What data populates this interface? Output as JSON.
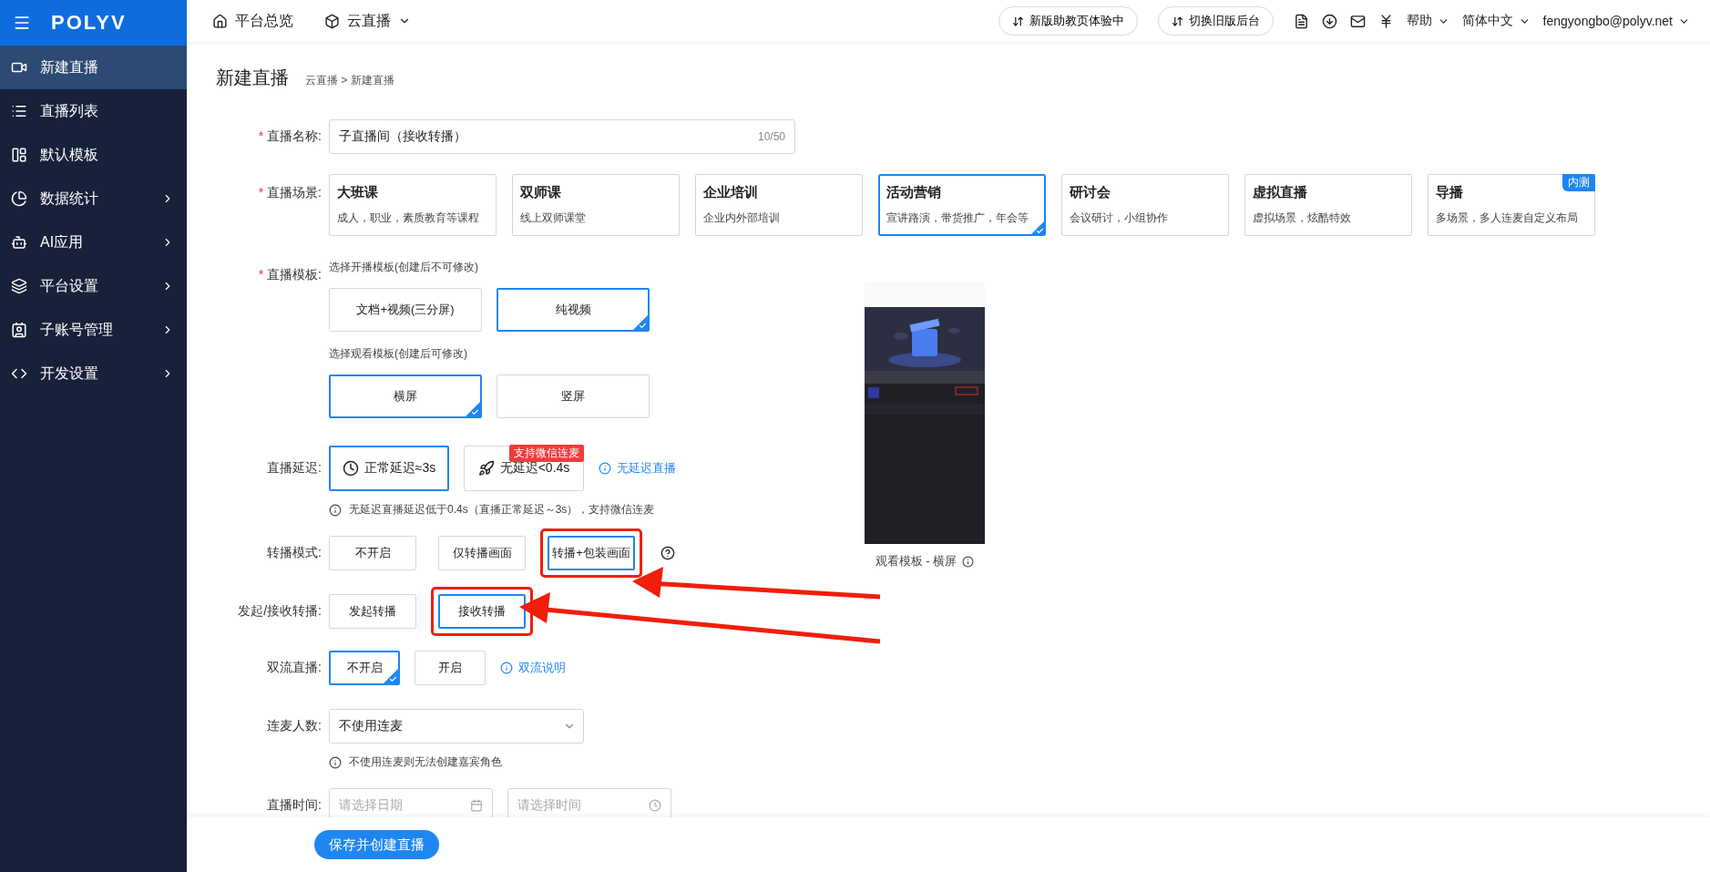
{
  "topbar": {
    "logo": "POLYV",
    "nav": [
      "平台总览",
      "云直播"
    ],
    "buttons": [
      "新版助教页体验中",
      "切换旧版后台"
    ],
    "help": "帮助",
    "language": "简体中文",
    "user": "fengyongbo@polyv.net"
  },
  "sidebar": {
    "items": [
      {
        "label": "新建直播",
        "selected": true,
        "has_submenu": false
      },
      {
        "label": "直播列表",
        "selected": false,
        "has_submenu": false
      },
      {
        "label": "默认模板",
        "selected": false,
        "has_submenu": false
      },
      {
        "label": "数据统计",
        "selected": false,
        "has_submenu": true
      },
      {
        "label": "AI应用",
        "selected": false,
        "has_submenu": true
      },
      {
        "label": "平台设置",
        "selected": false,
        "has_submenu": true
      },
      {
        "label": "子账号管理",
        "selected": false,
        "has_submenu": true
      },
      {
        "label": "开发设置",
        "selected": false,
        "has_submenu": true
      }
    ]
  },
  "page": {
    "title": "新建直播",
    "breadcrumb": "云直播 > 新建直播"
  },
  "name": {
    "label": "直播名称:",
    "required_mark": "*",
    "value": "子直播间（接收转播）",
    "counter": "10/50"
  },
  "scene": {
    "label": "直播场景:",
    "required_mark": "*",
    "options": [
      {
        "title": "大班课",
        "desc": "成人，职业，素质教育等课程",
        "selected": false
      },
      {
        "title": "双师课",
        "desc": "线上双师课堂",
        "selected": false
      },
      {
        "title": "企业培训",
        "desc": "企业内外部培训",
        "selected": false
      },
      {
        "title": "活动营销",
        "desc": "宣讲路演，带货推广，年会等",
        "selected": true
      },
      {
        "title": "研讨会",
        "desc": "会议研讨，小组协作",
        "selected": false
      },
      {
        "title": "虚拟直播",
        "desc": "虚拟场景，炫酷特效",
        "selected": false
      },
      {
        "title": "导播",
        "desc": "多场景，多人连麦自定义布局",
        "selected": false,
        "badge": "内测"
      }
    ]
  },
  "template": {
    "label": "直播模板:",
    "required_mark": "*",
    "hint": "选择开播模板(创建后不可修改)",
    "options": [
      {
        "label": "文档+视频(三分屏)",
        "selected": false
      },
      {
        "label": "纯视频",
        "selected": true
      }
    ],
    "watch_hint": "选择观看模板(创建后可修改)",
    "watch_options": [
      {
        "label": "横屏",
        "selected": true
      },
      {
        "label": "竖屏",
        "selected": false
      }
    ],
    "preview_caption": "观看模板 - 横屏"
  },
  "delay": {
    "label": "直播延迟:",
    "options": [
      {
        "label": "正常延迟≈3s",
        "selected": true
      },
      {
        "label": "无延迟<0.4s",
        "selected": false,
        "badge": "支持微信连麦"
      }
    ],
    "link": "无延迟直播",
    "note": "无延迟直播延迟低于0.4s（直播正常延迟～3s），支持微信连麦"
  },
  "relay_mode": {
    "label": "转播模式:",
    "options": [
      {
        "label": "不开启",
        "selected": false,
        "annotated": false
      },
      {
        "label": "仅转播画面",
        "selected": false,
        "annotated": false
      },
      {
        "label": "转播+包装画面",
        "selected": true,
        "annotated": true
      }
    ]
  },
  "relay_direction": {
    "label": "发起/接收转播:",
    "options": [
      {
        "label": "发起转播",
        "selected": false,
        "annotated": false
      },
      {
        "label": "接收转播",
        "selected": true,
        "annotated": true
      }
    ]
  },
  "dual_stream": {
    "label": "双流直播:",
    "options": [
      {
        "label": "不开启",
        "selected": true
      },
      {
        "label": "开启",
        "selected": false
      }
    ],
    "link": "双流说明"
  },
  "mic": {
    "label": "连麦人数:",
    "value": "不使用连麦",
    "note": "不使用连麦则无法创建嘉宾角色"
  },
  "time": {
    "label": "直播时间:",
    "date_placeholder": "请选择日期",
    "time_placeholder": "请选择时间"
  },
  "save_button": "保存并创建直播"
}
